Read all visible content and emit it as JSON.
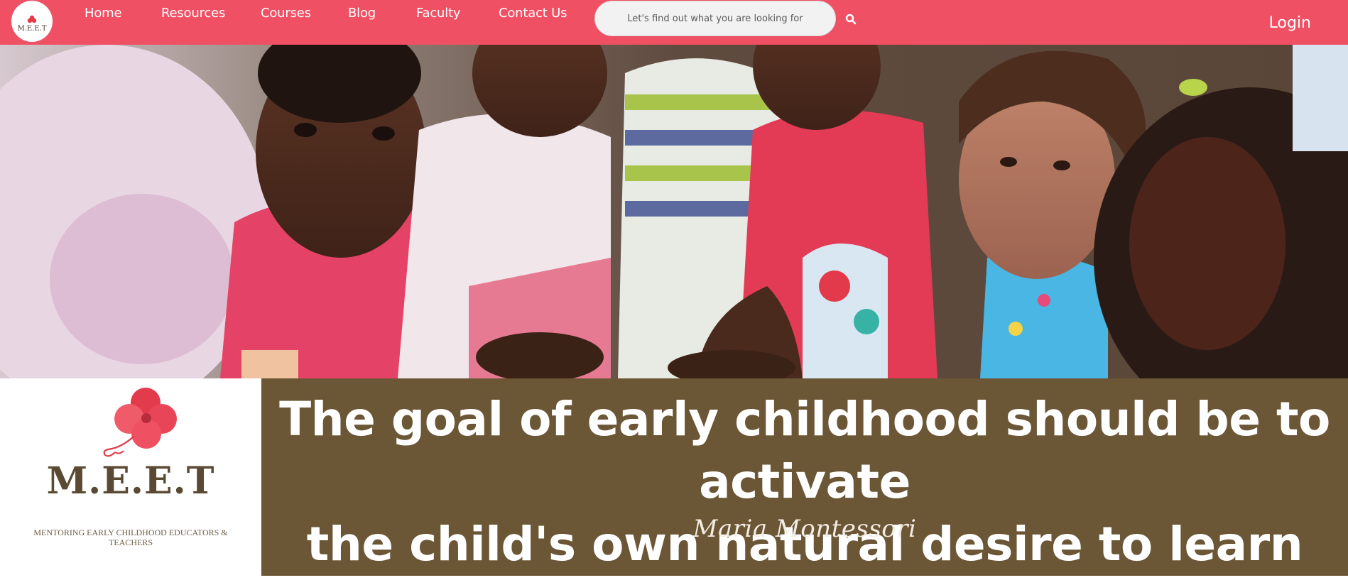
{
  "colors": {
    "accent": "#ef5064",
    "quote_bg": "#6b5636",
    "brand_brown": "#5a4a33"
  },
  "header": {
    "logo_text": "M.E.E.T",
    "nav": [
      {
        "label": "Home"
      },
      {
        "label": "Resources"
      },
      {
        "label": "Courses"
      },
      {
        "label": "Blog"
      },
      {
        "label": "Faculty"
      },
      {
        "label": "Contact Us"
      }
    ],
    "search": {
      "placeholder": "Let's find out what you are looking for",
      "icon": "search-icon"
    },
    "login_label": "Login"
  },
  "hero": {
    "icon": "hero-photo"
  },
  "brand": {
    "name": "M.E.E.T",
    "tagline": "MENTORING EARLY CHILDHOOD EDUCATORS & TEACHERS"
  },
  "quote": {
    "line1": "The goal of early childhood should be to activate",
    "line2": "the child's own natural desire to learn",
    "author": "Maria Montessori"
  }
}
